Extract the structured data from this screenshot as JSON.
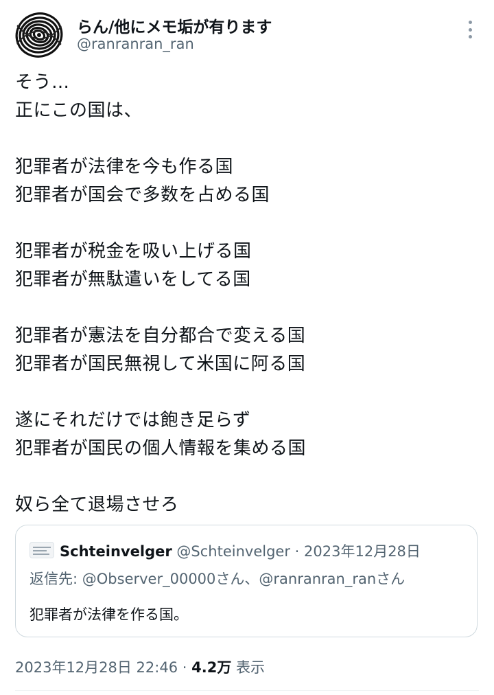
{
  "author": {
    "display_name": "らん/他にメモ垢が有ります",
    "handle": "@ranranran_ran",
    "avatar_icon": "spiral-avatar-icon"
  },
  "more_icon": "more-vertical-icon",
  "tweet": {
    "lines": [
      "そう…",
      "正にこの国は、",
      "",
      "犯罪者が法律を今も作る国",
      "犯罪者が国会で多数を占める国",
      "",
      "犯罪者が税金を吸い上げる国",
      "犯罪者が無駄遣いをしてる国",
      "",
      "犯罪者が憲法を自分都合で変える国",
      "犯罪者が国民無視して米国に阿る国",
      "",
      "遂にそれだけでは飽き足らず",
      "犯罪者が国民の個人情報を集める国",
      "",
      "奴ら全て退場させろ"
    ]
  },
  "quote": {
    "name": "Schteinvelger",
    "handle": "@Schteinvelger",
    "separator": "·",
    "date": "2023年12月28日",
    "reply_prefix": "返信先: ",
    "reply_mention_1": "@Observer_00000さん",
    "reply_joiner": "、",
    "reply_mention_2": "@ranranran_ranさん",
    "text": "犯罪者が法律を作る国。"
  },
  "meta": {
    "timestamp": "2023年12月28日 22:46",
    "separator": "·",
    "views_count": "4.2万",
    "views_label": "表示"
  },
  "colors": {
    "text": "#0f1419",
    "secondary": "#536471",
    "border": "#cfd9de"
  }
}
